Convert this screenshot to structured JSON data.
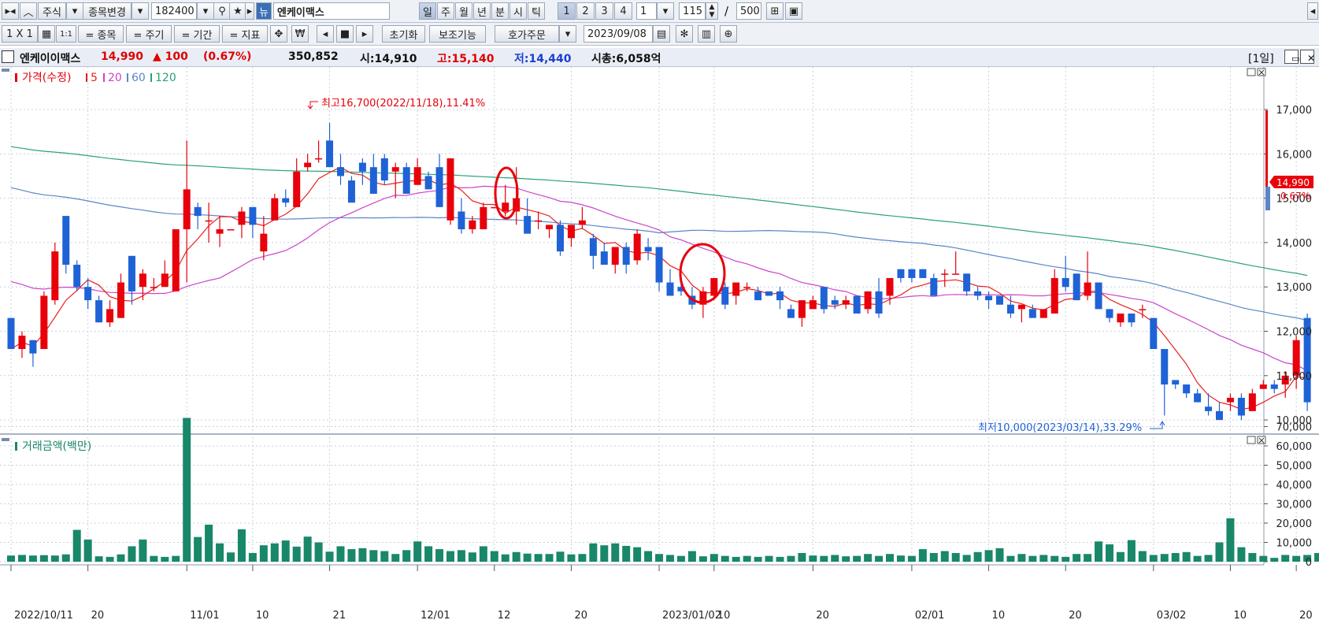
{
  "toolbar1": {
    "market": "주식",
    "change_item": "종목변경",
    "code": "182400",
    "stock_name": "엔케이맥스",
    "periods": [
      "일",
      "주",
      "월",
      "년",
      "분",
      "시",
      "틱"
    ],
    "page_tabs": [
      "1",
      "2",
      "3",
      "4"
    ],
    "tick_unit": "1",
    "count": "115",
    "separator": "/",
    "total": "500"
  },
  "toolbar2": {
    "layout": "1 X 1",
    "btn_item": "= 종목",
    "btn_period": "= 주기",
    "btn_range": "= 기간",
    "btn_indicator": "= 지표",
    "won": "₩",
    "reset": "초기화",
    "aux": "보조기능",
    "order": "호가주문",
    "date": "2023/09/08"
  },
  "header": {
    "name": "엔케이이맥스",
    "price": "14,990",
    "change": "▲ 100",
    "change_pct": "(0.67%)",
    "volume": "350,852",
    "open": "시:14,910",
    "high": "고:15,140",
    "low": "저:14,440",
    "mcap": "시총:6,058억",
    "period": "[1일]"
  },
  "legend": {
    "price": "가격(수정)",
    "ma5": "5",
    "ma20": "20",
    "ma60": "60",
    "ma120": "120",
    "volume": "거래금액(백만)"
  },
  "colors": {
    "up": "#e8000b",
    "down": "#1f62d6",
    "ma5": "#e8201a",
    "ma20": "#cc44cc",
    "ma60": "#5a86c8",
    "ma120": "#2aa17a",
    "volume": "#19876a"
  },
  "annotations": {
    "high": "최고16,700(2022/11/18),11.41%",
    "low": "최저10,000(2023/03/14),33.29%"
  },
  "price_badge": {
    "price": "14,990",
    "pct": "0.67%"
  },
  "chart_data": [
    {
      "type": "candlestick",
      "title": "가격(수정)",
      "ylim": [
        9900,
        17800
      ],
      "yticks": [
        "17,000",
        "16,000",
        "15,000",
        "14,000",
        "13,000",
        "12,000",
        "11,000",
        "10,000"
      ],
      "ytick_values": [
        17000,
        16000,
        15000,
        14000,
        13000,
        12000,
        11000,
        10000
      ],
      "xticks": [
        "2022/10/11",
        "20",
        "11/01",
        "10",
        "21",
        "12/01",
        "12",
        "20",
        "2023/01/02",
        "10",
        "20",
        "02/01",
        "10",
        "20",
        "03/02",
        "10",
        "20"
      ],
      "xtick_index": [
        0,
        7,
        16,
        22,
        29,
        37,
        44,
        51,
        59,
        64,
        73,
        82,
        89,
        96,
        104,
        111,
        117
      ],
      "ohlc": [
        [
          12300,
          12300,
          11600,
          11600
        ],
        [
          11600,
          12000,
          11400,
          11900
        ],
        [
          11800,
          11800,
          11200,
          11500
        ],
        [
          11600,
          12900,
          11600,
          12800
        ],
        [
          12700,
          14000,
          12600,
          13800
        ],
        [
          14600,
          14600,
          13300,
          13500
        ],
        [
          13500,
          13600,
          12900,
          13000
        ],
        [
          13000,
          13200,
          12500,
          12700
        ],
        [
          12700,
          12800,
          12200,
          12200
        ],
        [
          12200,
          12700,
          12100,
          12500
        ],
        [
          12300,
          13300,
          12300,
          13100
        ],
        [
          13700,
          13700,
          12600,
          12900
        ],
        [
          13000,
          13400,
          12700,
          13300
        ],
        [
          13000,
          13200,
          12900,
          13000
        ],
        [
          13000,
          13600,
          13000,
          13300
        ],
        [
          12900,
          14300,
          12900,
          14300
        ],
        [
          14300,
          16300,
          13100,
          15200
        ],
        [
          14800,
          14900,
          14300,
          14600
        ],
        [
          14500,
          14900,
          14000,
          14500
        ],
        [
          14200,
          14600,
          13900,
          14300
        ],
        [
          14300,
          14300,
          14300,
          14300
        ],
        [
          14400,
          14800,
          14100,
          14700
        ],
        [
          14800,
          14800,
          14100,
          14400
        ],
        [
          13800,
          14600,
          13600,
          14200
        ],
        [
          14500,
          15100,
          14500,
          15000
        ],
        [
          15000,
          15200,
          14800,
          14900
        ],
        [
          14800,
          15900,
          14800,
          15600
        ],
        [
          15700,
          16000,
          15600,
          15800
        ],
        [
          15900,
          16300,
          15800,
          15900
        ],
        [
          16300,
          16700,
          15700,
          15700
        ],
        [
          15700,
          16000,
          15300,
          15500
        ],
        [
          15400,
          15500,
          15000,
          14900
        ],
        [
          15800,
          15900,
          15300,
          15600
        ],
        [
          15700,
          16000,
          15200,
          15100
        ],
        [
          15900,
          16000,
          15300,
          15400
        ],
        [
          15600,
          15800,
          15000,
          15700
        ],
        [
          15700,
          15800,
          15200,
          15100
        ],
        [
          15300,
          15900,
          15300,
          15700
        ],
        [
          15500,
          15600,
          15200,
          15200
        ],
        [
          15700,
          16000,
          14800,
          14800
        ],
        [
          14500,
          15600,
          14400,
          15900
        ],
        [
          14700,
          15000,
          14200,
          14300
        ],
        [
          14300,
          14600,
          14200,
          14500
        ],
        [
          14300,
          14900,
          14300,
          14800
        ],
        [
          14800,
          14800,
          14800,
          14800
        ],
        [
          14700,
          15300,
          14600,
          14900
        ],
        [
          14700,
          15700,
          14400,
          15000
        ],
        [
          14600,
          15000,
          14400,
          14200
        ],
        [
          14500,
          14700,
          14300,
          14500
        ],
        [
          14300,
          14300,
          14100,
          14400
        ],
        [
          14400,
          14500,
          13700,
          13800
        ],
        [
          14100,
          14400,
          13900,
          14400
        ],
        [
          14400,
          14800,
          14300,
          14500
        ],
        [
          14100,
          14200,
          13400,
          13700
        ],
        [
          13800,
          14000,
          13500,
          13500
        ],
        [
          13500,
          13900,
          13300,
          13900
        ],
        [
          13900,
          14000,
          13300,
          13500
        ],
        [
          13600,
          14300,
          13500,
          14200
        ],
        [
          13900,
          14100,
          13600,
          13800
        ],
        [
          13900,
          13900,
          12900,
          13100
        ],
        [
          13100,
          13400,
          12900,
          12800
        ],
        [
          13000,
          13100,
          12800,
          12900
        ],
        [
          12800,
          13000,
          12500,
          12600
        ],
        [
          12600,
          13000,
          12300,
          12900
        ],
        [
          12800,
          13200,
          12700,
          13200
        ],
        [
          13000,
          13100,
          12500,
          12600
        ],
        [
          12800,
          13100,
          12600,
          13100
        ],
        [
          13000,
          13100,
          12900,
          13000
        ],
        [
          12900,
          13000,
          12700,
          12700
        ],
        [
          12900,
          12900,
          12800,
          12800
        ],
        [
          12900,
          13000,
          12500,
          12700
        ],
        [
          12500,
          12600,
          12300,
          12300
        ],
        [
          12300,
          12300,
          12100,
          12700
        ],
        [
          12500,
          12800,
          12500,
          12700
        ],
        [
          13000,
          13000,
          12400,
          12500
        ],
        [
          12700,
          12800,
          12500,
          12600
        ],
        [
          12600,
          12800,
          12500,
          12700
        ],
        [
          12800,
          12800,
          12600,
          12400
        ],
        [
          12500,
          12800,
          12400,
          12900
        ],
        [
          12900,
          13200,
          12300,
          12400
        ],
        [
          12800,
          13200,
          12600,
          13200
        ],
        [
          13400,
          13400,
          13100,
          13200
        ],
        [
          13400,
          13400,
          13100,
          13200
        ],
        [
          13400,
          13400,
          13200,
          13200
        ],
        [
          13200,
          13300,
          12800,
          12800
        ],
        [
          13300,
          13400,
          13000,
          13300
        ],
        [
          13300,
          13800,
          13300,
          13300
        ],
        [
          13300,
          13300,
          12800,
          12900
        ],
        [
          12900,
          13000,
          12700,
          12800
        ],
        [
          12800,
          12900,
          12500,
          12700
        ],
        [
          12800,
          12800,
          12600,
          12600
        ],
        [
          12600,
          12800,
          12300,
          12400
        ],
        [
          12500,
          12500,
          12200,
          12600
        ],
        [
          12500,
          12600,
          12400,
          12300
        ],
        [
          12300,
          12400,
          12300,
          12500
        ],
        [
          12400,
          13400,
          12400,
          13200
        ],
        [
          13200,
          13700,
          12900,
          13000
        ],
        [
          13300,
          13300,
          12900,
          12700
        ],
        [
          12800,
          13800,
          12700,
          13100
        ],
        [
          13100,
          13100,
          12700,
          12500
        ],
        [
          12500,
          12500,
          12200,
          12300
        ],
        [
          12200,
          12300,
          12100,
          12400
        ],
        [
          12400,
          12400,
          12100,
          12200
        ],
        [
          12500,
          12600,
          12300,
          12500
        ],
        [
          12300,
          12300,
          11800,
          11600
        ],
        [
          11600,
          11600,
          10100,
          10800
        ],
        [
          10900,
          10900,
          10700,
          10800
        ],
        [
          10800,
          10800,
          10500,
          10600
        ],
        [
          10600,
          10700,
          10400,
          10400
        ],
        [
          10300,
          10600,
          10100,
          10200
        ],
        [
          10200,
          10400,
          10000,
          10000
        ],
        [
          10400,
          10600,
          10200,
          10500
        ],
        [
          10500,
          10600,
          10000,
          10100
        ],
        [
          10200,
          10700,
          10200,
          10600
        ],
        [
          10700,
          10900,
          10700,
          10800
        ],
        [
          10800,
          10900,
          10600,
          10700
        ],
        [
          10800,
          11100,
          10500,
          11000
        ],
        [
          11000,
          11900,
          10700,
          11800
        ],
        [
          12300,
          12400,
          10200,
          10400
        ]
      ]
    },
    {
      "type": "bar",
      "title": "거래금액(백만)",
      "ylim": [
        0,
        80000
      ],
      "yticks": [
        "70,000",
        "60,000",
        "50,000",
        "40,000",
        "30,000",
        "20,000",
        "10,000",
        "0"
      ],
      "ytick_values": [
        70000,
        60000,
        50000,
        40000,
        30000,
        20000,
        10000,
        0
      ],
      "values": [
        3200,
        3500,
        3200,
        3400,
        3200,
        3800,
        16500,
        11500,
        2800,
        2500,
        3800,
        8000,
        11500,
        3000,
        2500,
        3000,
        74500,
        12800,
        19200,
        9500,
        4800,
        16800,
        4500,
        8500,
        9500,
        11000,
        7800,
        13000,
        10000,
        5200,
        8000,
        6500,
        7000,
        6000,
        5500,
        4000,
        6000,
        10500,
        8000,
        6500,
        5500,
        6000,
        4800,
        8000,
        5500,
        3800,
        5000,
        4200,
        4000,
        4000,
        5200,
        3800,
        4000,
        9500,
        8500,
        9500,
        8200,
        7500,
        5500,
        4000,
        3500,
        3000,
        5500,
        2800,
        4000,
        3000,
        2500,
        3000,
        2500,
        3000,
        2500,
        3000,
        4500,
        3200,
        3000,
        3500,
        2800,
        3000,
        4000,
        3000,
        4000,
        3200,
        3000,
        6500,
        4500,
        5500,
        4500,
        3500,
        5000,
        6000,
        7000,
        3000,
        4000,
        3000,
        3500,
        3000,
        2500,
        4000,
        4000,
        10500,
        9000,
        5000,
        11200,
        5500,
        3500,
        4000,
        4500,
        5000,
        3000,
        3500,
        10000,
        22500,
        7500,
        4500,
        3000,
        2000,
        3500,
        3000,
        3500,
        4500,
        2500,
        3500,
        9500,
        18500
      ]
    }
  ]
}
